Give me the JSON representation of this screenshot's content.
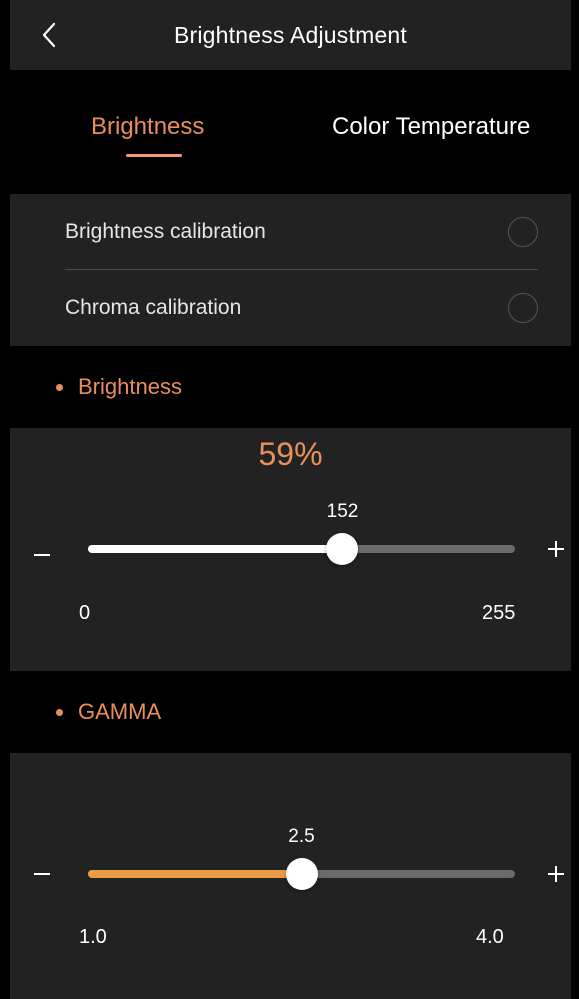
{
  "header": {
    "title": "Brightness Adjustment",
    "back_icon": "chevron-left-icon"
  },
  "tabs": [
    {
      "label": "Brightness",
      "active": true
    },
    {
      "label": "Color Temperature",
      "active": false
    }
  ],
  "calibration": [
    {
      "label": "Brightness calibration",
      "selected": false
    },
    {
      "label": "Chroma calibration",
      "selected": false
    }
  ],
  "brightness": {
    "section_title": "Brightness",
    "percent": "59%",
    "value": "152",
    "min": "0",
    "max": "255",
    "fraction": 0.596,
    "fill_color": "#ffffff"
  },
  "gamma": {
    "section_title": "GAMMA",
    "value": "2.5",
    "min": "1.0",
    "max": "4.0",
    "fraction": 0.5,
    "fill_color": "#e99b48"
  },
  "colors": {
    "accent": "#e98f5b",
    "underline": "#f1997a",
    "panel": "#222222",
    "section_bg": "#000000",
    "track": "#6b6b6b"
  }
}
